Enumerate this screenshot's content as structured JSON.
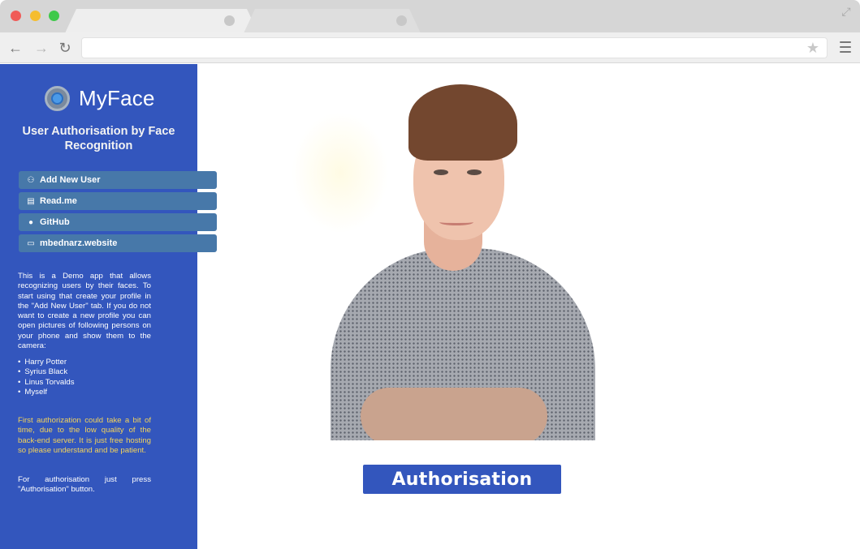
{
  "browser": {
    "url": "",
    "icons": {
      "back": "back-arrow-icon",
      "forward": "forward-arrow-icon",
      "reload": "reload-icon",
      "bookmark": "star-icon",
      "menu": "hamburger-menu-icon",
      "expand": "expand-icon"
    }
  },
  "sidebar": {
    "brand": "MyFace",
    "subtitle": "User Authorisation by Face Recognition",
    "buttons": [
      {
        "label": "Add New User",
        "icon": "add-user-icon"
      },
      {
        "label": "Read.me",
        "icon": "document-icon"
      },
      {
        "label": "GitHub",
        "icon": "github-icon"
      },
      {
        "label": "mbednarz.website",
        "icon": "browser-window-icon"
      }
    ],
    "description": "This is a Demo app that allows recognizing users by their faces. To start using that create your profile in the \"Add New User\" tab. If you do not want to create a new profile you can open pictures of following persons on your phone and show them to the camera:",
    "persons": [
      "Harry Potter",
      "Syrius Black",
      "Linus Torvalds",
      "Myself"
    ],
    "warning": "First authorization could take a bit of time, due to the low quality of the back-end server. It is just free hosting so please understand and be patient.",
    "hint": "For authorisation just press \"Authorisation\" button."
  },
  "main": {
    "auth_button": "Authorisation"
  },
  "colors": {
    "sidebar": "#3356bd",
    "sidebar_button": "#4778a9",
    "warning_text": "#f3d35b"
  }
}
